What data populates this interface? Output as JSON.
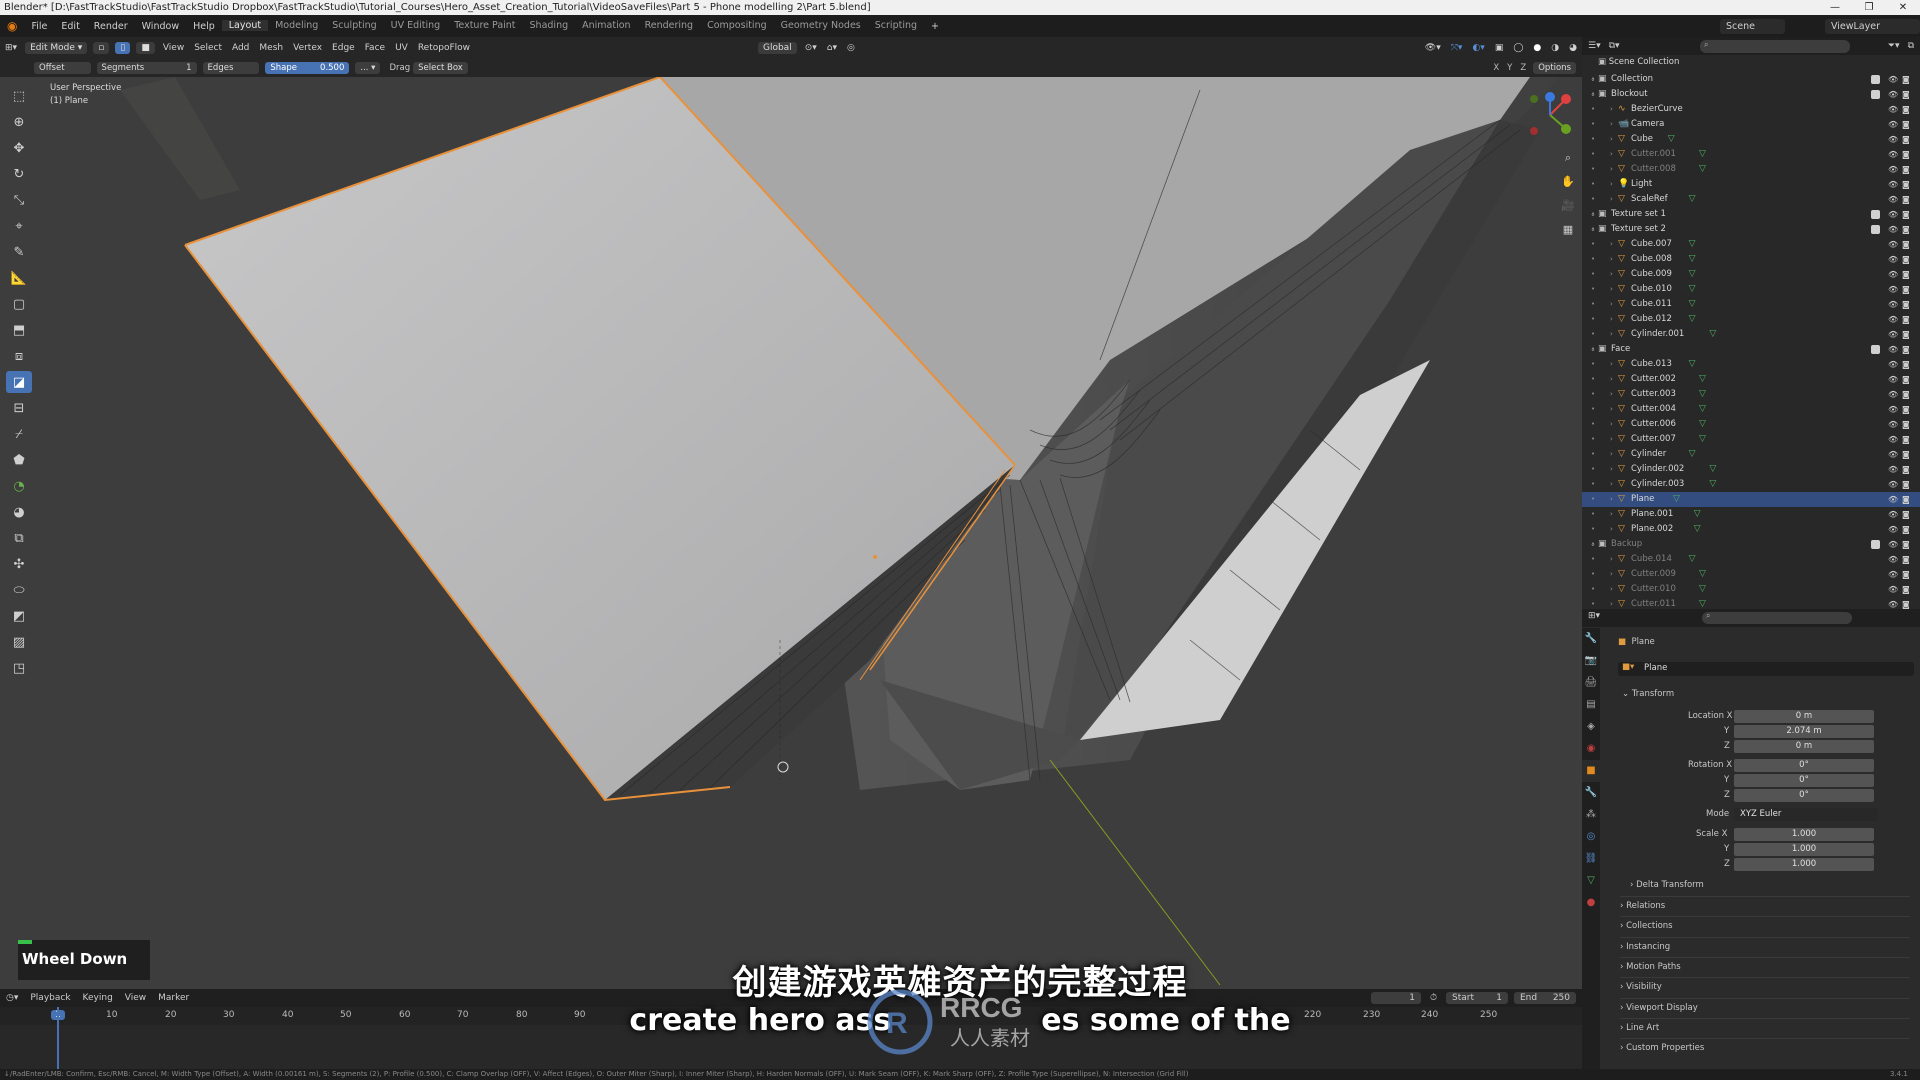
{
  "window": {
    "title": "Blender* [D:\\FastTrackStudio\\FastTrackStudio Dropbox\\FastTrackStudio\\Tutorial_Courses\\Hero_Asset_Creation_Tutorial\\VideoSaveFiles\\Part 5 - Phone modelling 2\\Part 5.blend]",
    "controls": [
      "—",
      "❐",
      "✕"
    ]
  },
  "menubar": {
    "menus": [
      "File",
      "Edit",
      "Render",
      "Window",
      "Help"
    ],
    "workspaces": [
      "Layout",
      "Modeling",
      "Sculpting",
      "UV Editing",
      "Texture Paint",
      "Shading",
      "Animation",
      "Rendering",
      "Compositing",
      "Geometry Nodes",
      "Scripting"
    ],
    "active_workspace": "Layout",
    "scene": "Scene",
    "view_layer": "ViewLayer"
  },
  "viewport_header": {
    "mode": "Edit Mode",
    "menus": [
      "View",
      "Select",
      "Add",
      "Mesh",
      "Vertex",
      "Edge",
      "Face",
      "UV"
    ],
    "addon": "RetopoFlow",
    "orientation": "Global",
    "options_label": "Options",
    "axes": [
      "X",
      "Y",
      "Z"
    ]
  },
  "operator_bar": {
    "offset_label": "Offset",
    "segments_label": "Segments",
    "segments_value": "1",
    "edges_label": "Edges",
    "shape_label": "Shape",
    "shape_value": "0.500",
    "drag_label": "Drag",
    "select_box_label": "Select Box"
  },
  "viewport": {
    "perspective_label": "User Perspective",
    "object_label": "(1) Plane"
  },
  "key_overlay": "Wheel Down",
  "timeline": {
    "menus": [
      "Playback",
      "Keying",
      "View",
      "Marker"
    ],
    "current_frame": "1",
    "start_label": "Start",
    "start": "1",
    "end_label": "End",
    "end": "250",
    "ruler": [
      "1",
      "10",
      "20",
      "30",
      "40",
      "50",
      "60",
      "70",
      "80",
      "90",
      "210",
      "220",
      "230",
      "240",
      "250"
    ]
  },
  "statusbar": "↓/RadEnter/LMB: Confirm, Esc/RMB: Cancel, M: Width Type (Offset), A: Width (0.00161 m), S: Segments (2), P: Profile (0.500), C: Clamp Overlap (OFF), V: Affect (Edges), O: Outer Miter (Sharp), I: Inner Miter (Sharp), H: Harden Normals (OFF), U: Mark Seam (OFF), K: Mark Sharp (OFF), Z: Profile Type (Superellipse), N: Intersection (Grid Fill)",
  "version": "3.4.1",
  "outliner": {
    "root": "Scene Collection",
    "rows": [
      {
        "name": "Collection",
        "depth": 1,
        "kind": "collection",
        "dim": false
      },
      {
        "name": "Blockout",
        "depth": 1,
        "kind": "collection",
        "dim": false
      },
      {
        "name": "BezierCurve",
        "depth": 2,
        "kind": "curve",
        "dim": false
      },
      {
        "name": "Camera",
        "depth": 2,
        "kind": "camera",
        "dim": false
      },
      {
        "name": "Cube",
        "depth": 2,
        "kind": "mesh",
        "dim": false
      },
      {
        "name": "Cutter.001",
        "depth": 2,
        "kind": "mesh",
        "dim": true
      },
      {
        "name": "Cutter.008",
        "depth": 2,
        "kind": "mesh",
        "dim": true
      },
      {
        "name": "Light",
        "depth": 2,
        "kind": "light",
        "dim": false
      },
      {
        "name": "ScaleRef",
        "depth": 2,
        "kind": "mesh",
        "dim": false
      },
      {
        "name": "Texture set 1",
        "depth": 1,
        "kind": "collection",
        "dim": false
      },
      {
        "name": "Texture set 2",
        "depth": 1,
        "kind": "collection",
        "dim": false
      },
      {
        "name": "Cube.007",
        "depth": 2,
        "kind": "mesh",
        "dim": false
      },
      {
        "name": "Cube.008",
        "depth": 2,
        "kind": "mesh",
        "dim": false
      },
      {
        "name": "Cube.009",
        "depth": 2,
        "kind": "mesh",
        "dim": false
      },
      {
        "name": "Cube.010",
        "depth": 2,
        "kind": "mesh",
        "dim": false
      },
      {
        "name": "Cube.011",
        "depth": 2,
        "kind": "mesh",
        "dim": false
      },
      {
        "name": "Cube.012",
        "depth": 2,
        "kind": "mesh",
        "dim": false
      },
      {
        "name": "Cylinder.001",
        "depth": 2,
        "kind": "mesh",
        "dim": false
      },
      {
        "name": "Face",
        "depth": 1,
        "kind": "collection",
        "dim": false
      },
      {
        "name": "Cube.013",
        "depth": 2,
        "kind": "mesh",
        "dim": false
      },
      {
        "name": "Cutter.002",
        "depth": 2,
        "kind": "mesh",
        "dim": false
      },
      {
        "name": "Cutter.003",
        "depth": 2,
        "kind": "mesh",
        "dim": false
      },
      {
        "name": "Cutter.004",
        "depth": 2,
        "kind": "mesh",
        "dim": false
      },
      {
        "name": "Cutter.006",
        "depth": 2,
        "kind": "mesh",
        "dim": false
      },
      {
        "name": "Cutter.007",
        "depth": 2,
        "kind": "mesh",
        "dim": false
      },
      {
        "name": "Cylinder",
        "depth": 2,
        "kind": "mesh",
        "dim": false
      },
      {
        "name": "Cylinder.002",
        "depth": 2,
        "kind": "mesh",
        "dim": false
      },
      {
        "name": "Cylinder.003",
        "depth": 2,
        "kind": "mesh",
        "dim": false
      },
      {
        "name": "Plane",
        "depth": 2,
        "kind": "mesh",
        "dim": false,
        "selected": true
      },
      {
        "name": "Plane.001",
        "depth": 2,
        "kind": "mesh",
        "dim": false
      },
      {
        "name": "Plane.002",
        "depth": 2,
        "kind": "mesh",
        "dim": false
      },
      {
        "name": "Backup",
        "depth": 1,
        "kind": "collection",
        "dim": true
      },
      {
        "name": "Cube.014",
        "depth": 2,
        "kind": "mesh",
        "dim": true
      },
      {
        "name": "Cutter.009",
        "depth": 2,
        "kind": "mesh",
        "dim": true
      },
      {
        "name": "Cutter.010",
        "depth": 2,
        "kind": "mesh",
        "dim": true
      },
      {
        "name": "Cutter.011",
        "depth": 2,
        "kind": "mesh",
        "dim": true
      }
    ]
  },
  "properties": {
    "object_name": "Plane",
    "data_name": "Plane",
    "transform_label": "Transform",
    "location_label": "Location X",
    "location": [
      "0 m",
      "2.074 m",
      "0 m"
    ],
    "rotation_label": "Rotation X",
    "rotation": [
      "0°",
      "0°",
      "0°"
    ],
    "mode_label": "Mode",
    "mode": "XYZ Euler",
    "scale_label": "Scale X",
    "scale": [
      "1.000",
      "1.000",
      "1.000"
    ],
    "axis_y": "Y",
    "axis_z": "Z",
    "sections": [
      "Delta Transform",
      "Relations",
      "Collections",
      "Instancing",
      "Motion Paths",
      "Visibility",
      "Viewport Display",
      "Line Art",
      "Custom Properties"
    ]
  },
  "subtitles": {
    "zh": "创建游戏英雄资产的完整过程",
    "en": "create hero ass",
    "en_end": "es some of the"
  },
  "watermark": {
    "logo": "RRCG",
    "text": "人人素材"
  },
  "colors": {
    "selection_orange": "#e8913a",
    "active_blue": "#4772b3",
    "outliner_selected": "#334d80"
  }
}
